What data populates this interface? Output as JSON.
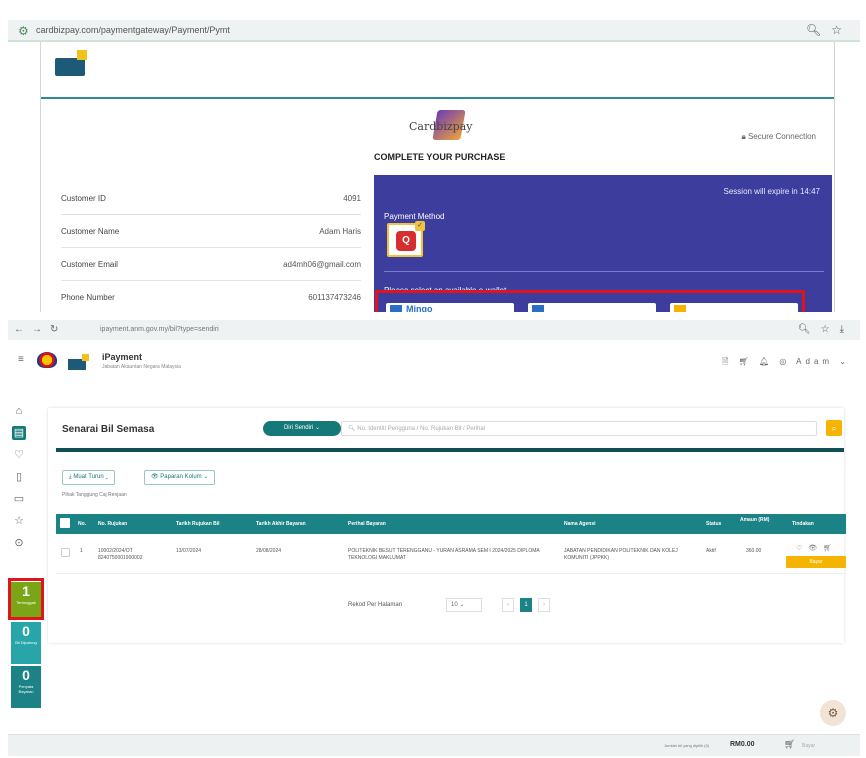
{
  "top": {
    "url": "cardbizpay.com/paymentgateway/Payment/Pymt",
    "complete_title": "COMPLETE YOUR PURCHASE",
    "secure": "Secure Connection",
    "session": "Session will expire in 14:47",
    "payment_method_label": "Payment Method",
    "ewallet_label": "Please select an available e-wallet.",
    "customer": [
      {
        "label": "Customer ID",
        "value": "4091"
      },
      {
        "label": "Customer Name",
        "value": "Adam Haris"
      },
      {
        "label": "Customer Email",
        "value": "ad4mh06@gmail.com"
      },
      {
        "label": "Phone Number",
        "value": "601137473246"
      }
    ]
  },
  "bottom": {
    "url": "ipayment.anm.gov.my/bil?type=sendiri",
    "app_title": "iPayment",
    "app_subtitle": "Jabatan Akauntan Negara Malaysia",
    "user": "Adam",
    "page_title": "Senarai Bil Semasa",
    "pill": "Diri Sendiri",
    "search_placeholder": "No. Identiti Pengguna / No. Rujukan Bil / Perihal",
    "btn_download": "Muat Turun",
    "btn_columns": "Paparan Kolum",
    "filter_note": "Pihak Tanggung Caj Renjaan",
    "columns": [
      "No.",
      "No. Rujukan",
      "Tarikh Rujukan Bil",
      "Tarikh Akhir Bayaran",
      "Perihal Bayaran",
      "Nama Agensi",
      "Status",
      "Amaun (RM)",
      "Tindakan"
    ],
    "row": {
      "no": "1",
      "ref": "10002/2024/OT 8240750001900002",
      "ref_date": "13/07/2024",
      "due_date": "28/08/2024",
      "description": "POLITEKNIK BESUT TERENGGANU - YURAN ASRAMA SEM I 2024/2025 DIPLOMA TEKNOLOGI MAKLUMAT",
      "agency": "JABATAN PENDIDIKAN POLITEKNIK DAN KOLEJ KOMUNITI (JPPKK)",
      "status": "Aktif",
      "amount": "360.00",
      "pay_button": "Bayar"
    },
    "pager_label": "Rekod Per Halaman",
    "pager_size": "10",
    "current_page": "1",
    "side_counts": [
      {
        "n": "1",
        "label": "Tertunggak"
      },
      {
        "n": "0",
        "label": "Bil Dipotong"
      },
      {
        "n": "0",
        "label": "Penyata Bayaran"
      }
    ],
    "footer_label": "Jumlah bil yang dipilih (0)",
    "footer_amount": "RM0.00",
    "footer_pay": "Bayar"
  },
  "colors": {
    "teal": "#15797a",
    "panel": "#3d3d9e",
    "accent": "#f4b400",
    "highlight": "#e0151b"
  }
}
